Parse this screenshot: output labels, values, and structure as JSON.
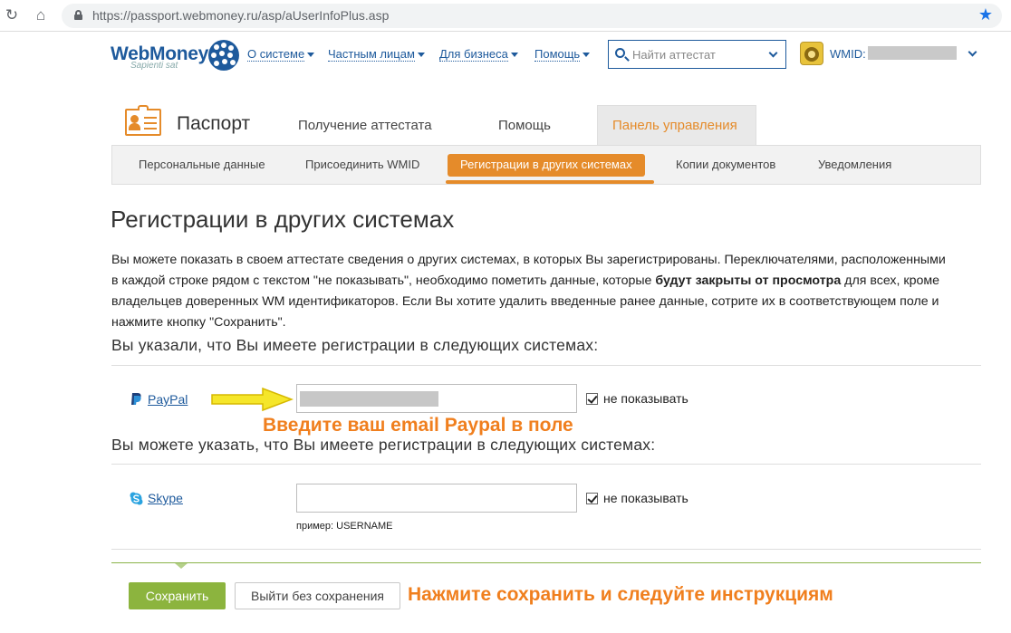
{
  "browser": {
    "url": "https://passport.webmoney.ru/asp/aUserInfoPlus.asp"
  },
  "header": {
    "logo_text": "WebMoney",
    "logo_tagline": "Sapienti sat",
    "nav": [
      "О системе",
      "Частным лицам",
      "Для бизнеса",
      "Помощь"
    ],
    "search_placeholder": "Найти аттестат",
    "wmid_label": "WMID:"
  },
  "passport": {
    "title": "Паспорт",
    "tabs": [
      "Получение аттестата",
      "Помощь",
      "Панель управления"
    ],
    "active_tab": "Панель управления",
    "subtabs": [
      "Персональные данные",
      "Присоединить WMID",
      "Регистрации в других системах",
      "Копии документов",
      "Уведомления"
    ],
    "active_subtab": "Регистрации в других системах"
  },
  "page": {
    "heading": "Регистрации в других системах",
    "intro_part1": "Вы можете показать в своем аттестате сведения о других системах, в которых Вы зарегистрированы. Переключателями, расположенными в каждой строке рядом с текстом \"не показывать\", необходимо пометить данные, которые ",
    "intro_bold": "будут закрыты от просмотра",
    "intro_part2": " для всех, кроме владельцев доверенных WM идентификаторов. Если Вы хотите удалить введенные ранее данные, сотрите их в соответствующем поле и нажмите кнопку \"Сохранить\".",
    "registered_title": "Вы указали, что Вы имеете регистрации в следующих системах:",
    "available_title": "Вы можете указать, что Вы имеете регистрации в следующих системах:",
    "services": [
      {
        "name": "PayPal",
        "hide_label": "не показывать",
        "hidden": true
      },
      {
        "name": "Skype",
        "hide_label": "не показывать",
        "hidden": true,
        "example": "пример: USERNAME"
      }
    ],
    "save_button": "Сохранить",
    "exit_button": "Выйти без сохранения"
  },
  "annotations": {
    "paypal_hint": "Введите ваш email Paypal в поле",
    "save_hint": "Нажмите сохранить и следуйте инструкциям"
  },
  "colors": {
    "brand_blue": "#1e5a9c",
    "accent_orange": "#e58b2a",
    "annotation_orange": "#f07f1e",
    "save_green": "#8cb43e"
  }
}
